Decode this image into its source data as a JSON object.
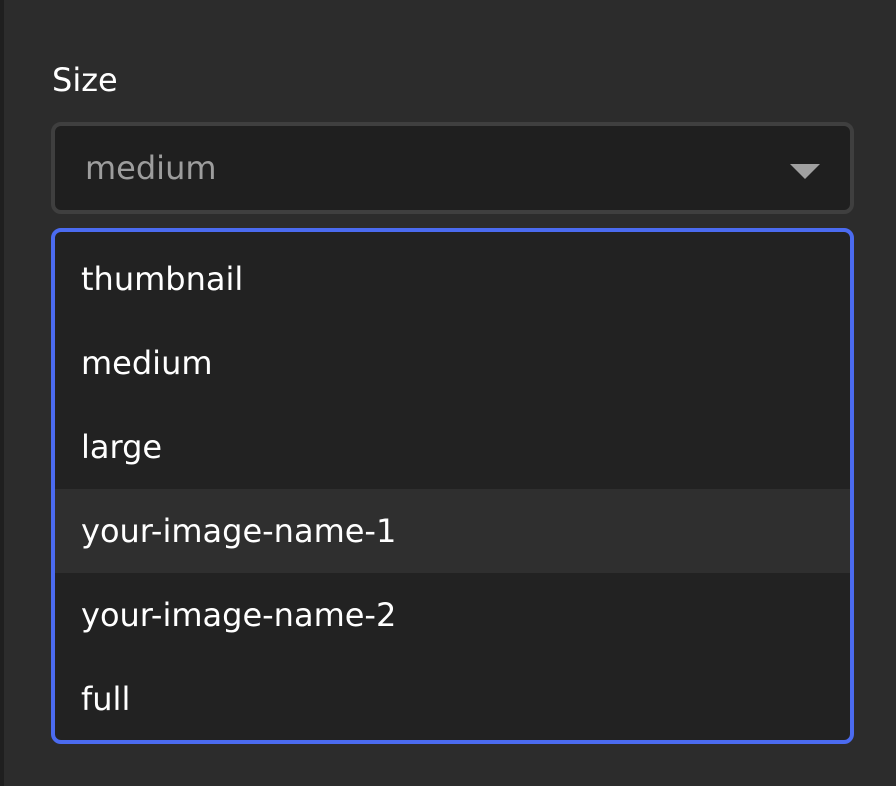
{
  "colors": {
    "background": "#2c2c2c",
    "field_background": "#1f1f1f",
    "field_border": "#3f3f3f",
    "list_background": "#222222",
    "focus_border": "#4b6bf0",
    "highlight_row": "#2f2f2f",
    "label_text": "#ffffff",
    "selected_value_text": "#9d9d9d"
  },
  "field": {
    "label": "Size",
    "selected_value": "medium",
    "arrow_icon": "chevron-down-icon"
  },
  "dropdown": {
    "highlighted_index": 3,
    "options": [
      {
        "label": "thumbnail"
      },
      {
        "label": "medium"
      },
      {
        "label": "large"
      },
      {
        "label": "your-image-name-1"
      },
      {
        "label": "your-image-name-2"
      },
      {
        "label": "full"
      }
    ]
  }
}
